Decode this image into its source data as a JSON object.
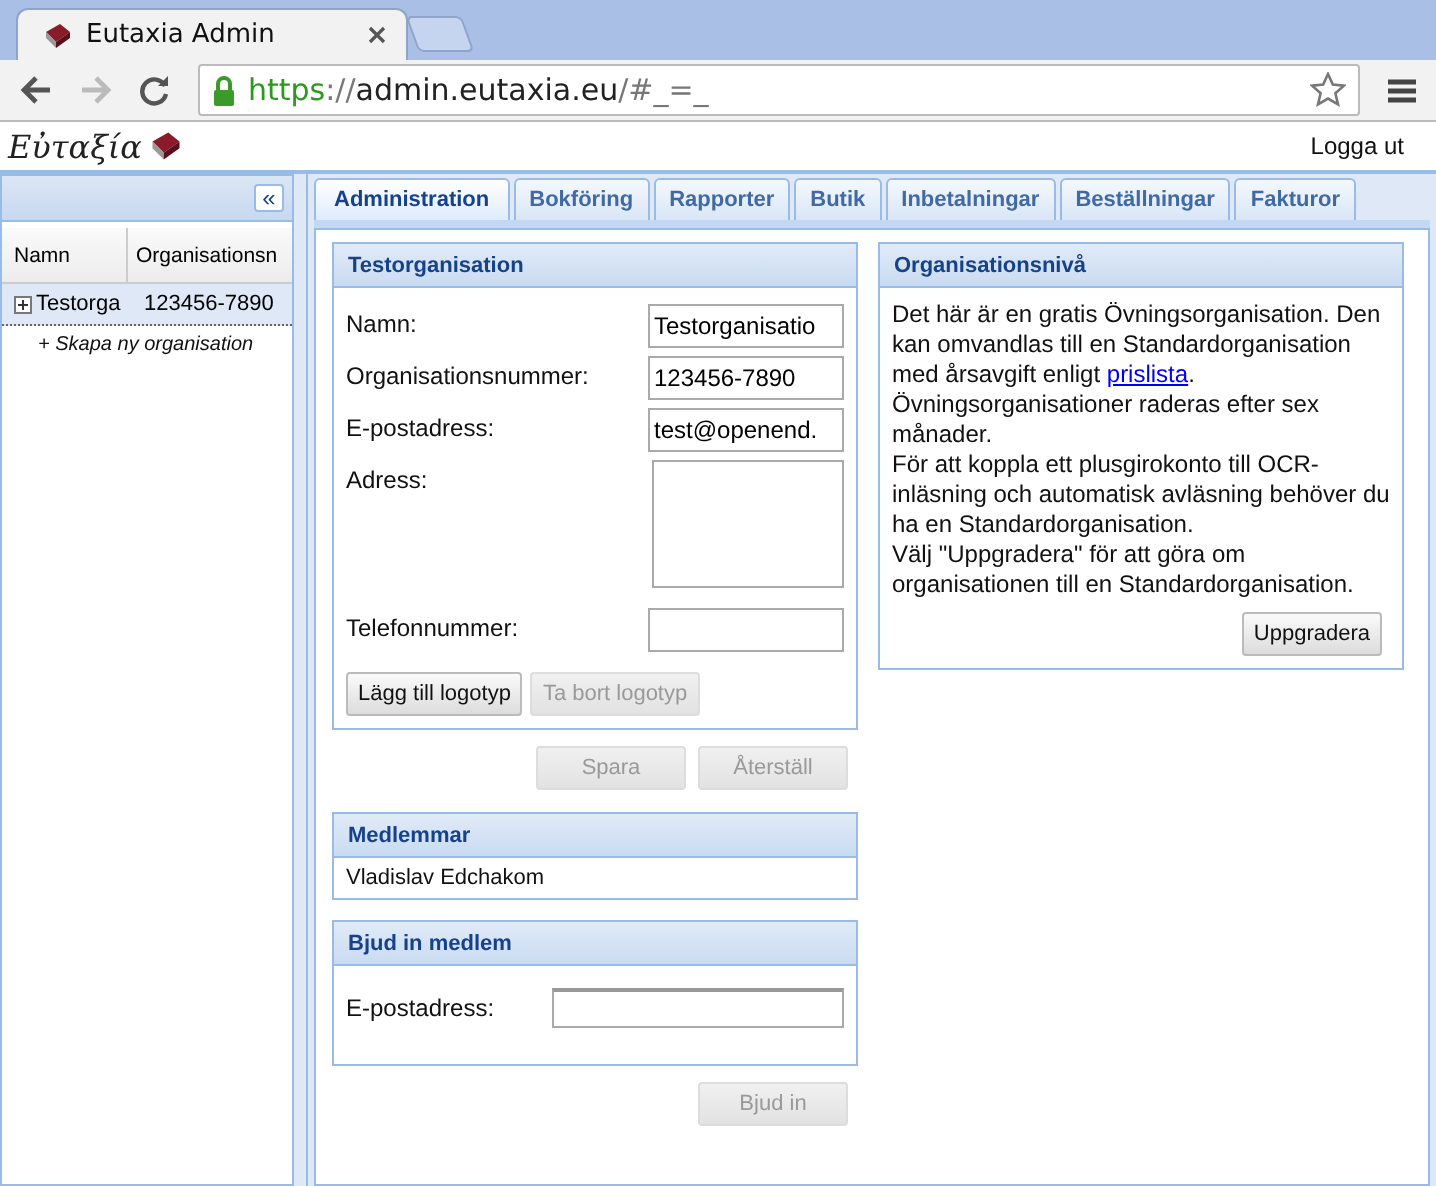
{
  "browser": {
    "tab_title": "Eutaxia Admin",
    "url_scheme": "https",
    "url_sep": "://",
    "url_host": "admin.eutaxia.eu",
    "url_rest": "/#_=_"
  },
  "header": {
    "logo": "Εὐταξία",
    "logout": "Logga ut"
  },
  "sidebar": {
    "collapse": "«",
    "columns": [
      "Namn",
      "Organisationsn"
    ],
    "rows": [
      {
        "name": "Testorga",
        "number": "123456-7890",
        "selected": true
      }
    ],
    "new_item": "+ Skapa ny organisation"
  },
  "tabs": [
    {
      "label": "Administration",
      "selected": true
    },
    {
      "label": "Bokföring",
      "selected": false
    },
    {
      "label": "Rapporter",
      "selected": false
    },
    {
      "label": "Butik",
      "selected": false
    },
    {
      "label": "Inbetalningar",
      "selected": false
    },
    {
      "label": "Beställningar",
      "selected": false
    },
    {
      "label": "Fakturor",
      "selected": false
    }
  ],
  "org_panel": {
    "title": "Testorganisation",
    "fields": [
      {
        "label": "Namn:",
        "value": "Testorganisatio",
        "kind": "input"
      },
      {
        "label": "Organisationsnummer:",
        "value": "123456-7890",
        "kind": "input"
      },
      {
        "label": "E-postadress:",
        "value": "test@openend.",
        "kind": "input"
      },
      {
        "label": "Adress:",
        "kind": "textarea"
      },
      {
        "label": "Telefonnummer:",
        "kind": "input"
      }
    ],
    "buttons": [
      {
        "label": "Lägg till logotyp",
        "disabled": false
      },
      {
        "label": "Ta bort logotyp",
        "disabled": true
      }
    ]
  },
  "form_buttons": [
    {
      "label": "Spara",
      "disabled": true
    },
    {
      "label": "Återställ",
      "disabled": true
    }
  ],
  "members_panel": {
    "title": "Medlemmar",
    "members": [
      "Vladislav Edchakom"
    ]
  },
  "invite_panel": {
    "title": "Bjud in medlem",
    "label": "E-postadress:",
    "button": {
      "label": "Bjud in",
      "disabled": true
    }
  },
  "level_panel": {
    "title": "Organisationsnivå",
    "paragraphs": [
      {
        "text": "Det här är en gratis Övningsorganisation. Den kan omvandlas till en Standardorganisation med årsavgift enligt ",
        "link": "prislista",
        "after": "."
      },
      {
        "text": "Övningsorganisationer raderas efter sex månader."
      },
      {
        "text": "För att koppla ett plusgirokonto till OCR-inläsning och automatisk avläsning behöver du ha en Standardorganisation."
      },
      {
        "text": "Välj \"Uppgradera\" för att göra om organisationen till en Standardorganisation."
      }
    ],
    "button": {
      "label": "Uppgradera",
      "disabled": false
    }
  }
}
